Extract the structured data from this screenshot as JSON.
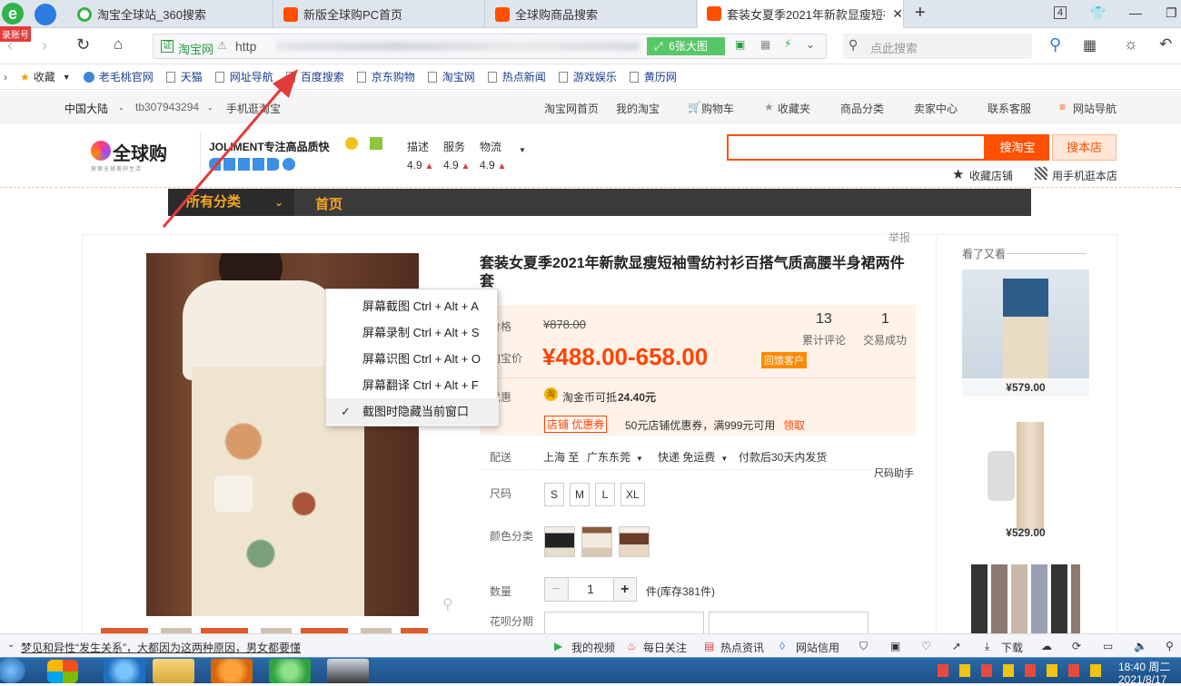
{
  "browser": {
    "badge": "录账号",
    "tabs": [
      {
        "label": "淘宝全球站_360搜索"
      },
      {
        "label": "新版全球购PC首页"
      },
      {
        "label": "全球购商品搜索"
      },
      {
        "label": "套装女夏季2021年新款显瘦短袖"
      }
    ],
    "tab_count": "4",
    "address": {
      "site_label": "淘宝网",
      "url_prefix": "http",
      "image_mode_label": "6张大图"
    },
    "search_placeholder": "点此搜索"
  },
  "bookmarks": [
    {
      "label": "收藏"
    },
    {
      "label": "老毛桃官网"
    },
    {
      "label": "天猫"
    },
    {
      "label": "网址导航"
    },
    {
      "label": "百度搜索"
    },
    {
      "label": "京东购物"
    },
    {
      "label": "淘宝网"
    },
    {
      "label": "热点新闻"
    },
    {
      "label": "游戏娱乐"
    },
    {
      "label": "黄历网"
    }
  ],
  "sitenav": {
    "region": "中国大陆",
    "user": "tb307943294",
    "mobile": "手机逛淘宝",
    "home": "淘宝网首页",
    "my_taobao": "我的淘宝",
    "cart": "购物车",
    "favorites": "收藏夹",
    "categories": "商品分类",
    "seller": "卖家中心",
    "service": "联系客服",
    "site_nav": "网站导航"
  },
  "shop": {
    "logo_text": "全球购",
    "logo_sub": "探索全球美好生活",
    "name": "JOLIMENT专注高品质快",
    "ratings": [
      {
        "label": "描述",
        "score": "4.9"
      },
      {
        "label": "服务",
        "score": "4.9"
      },
      {
        "label": "物流",
        "score": "4.9"
      }
    ],
    "search_taobao_btn": "搜淘宝",
    "search_shop_btn": "搜本店",
    "fav_shop": "收藏店铺",
    "mobile_shop": "用手机逛本店",
    "nav_all": "所有分类",
    "nav_home": "首页"
  },
  "product": {
    "report": "举报",
    "title": "套装女夏季2021年新款显瘦短袖雪纺衬衫百搭气质高腰半身裙两件套",
    "price_label": "价格",
    "original_price": "¥878.00",
    "promo_label": "淘宝价",
    "promo_price": "¥488.00-658.00",
    "promo_tag": "回馈客户",
    "reviews_count": "13",
    "reviews_label": "累计评论",
    "sales_count": "1",
    "sales_label": "交易成功",
    "discount_label": "优惠",
    "coin_text": "淘金币可抵",
    "coin_amount": "24.40元",
    "coupon_tag": "店铺 优惠券",
    "coupon_text": "50元店铺优惠券，满999元可用",
    "coupon_link": "领取",
    "shipping_label": "配送",
    "ship_from": "上海 至",
    "ship_to": "广东东莞",
    "ship_method": "快递 免运费",
    "ship_time": "付款后30天内发货",
    "size_helper": "尺码助手",
    "size_label": "尺码",
    "sizes": [
      "S",
      "M",
      "L",
      "XL"
    ],
    "color_label": "颜色分类",
    "qty_label": "数量",
    "qty_value": "1",
    "qty_minus": "−",
    "qty_plus": "+",
    "stock_text": "件(库存381件)",
    "installment_label": "花呗分期"
  },
  "recommend": {
    "title": "看了又看",
    "items": [
      {
        "price": "¥579.00"
      },
      {
        "price": "¥529.00"
      },
      {
        "price": ""
      }
    ]
  },
  "context_menu": {
    "items": [
      {
        "label": "屏幕截图 Ctrl + Alt + A"
      },
      {
        "label": "屏幕录制 Ctrl + Alt + S"
      },
      {
        "label": "屏幕识图 Ctrl + Alt + O"
      },
      {
        "label": "屏幕翻译 Ctrl + Alt + F"
      },
      {
        "label": "截图时隐藏当前窗口",
        "checked": true
      }
    ]
  },
  "statusbar": {
    "news": "梦见和异性“发生关系”，大都因为这两种原因，男女都要懂",
    "video": "我的视频",
    "daily": "每日关注",
    "hot": "热点资讯",
    "credit": "网站信用",
    "download": "下载"
  },
  "taskbar": {
    "time": "18:40 周二",
    "date": "2021/8/17"
  },
  "colors": {
    "accent": "#ff5000",
    "shop_nav": "#3b3b3b",
    "price": "#ff4400",
    "link": "#1a3c8f"
  }
}
